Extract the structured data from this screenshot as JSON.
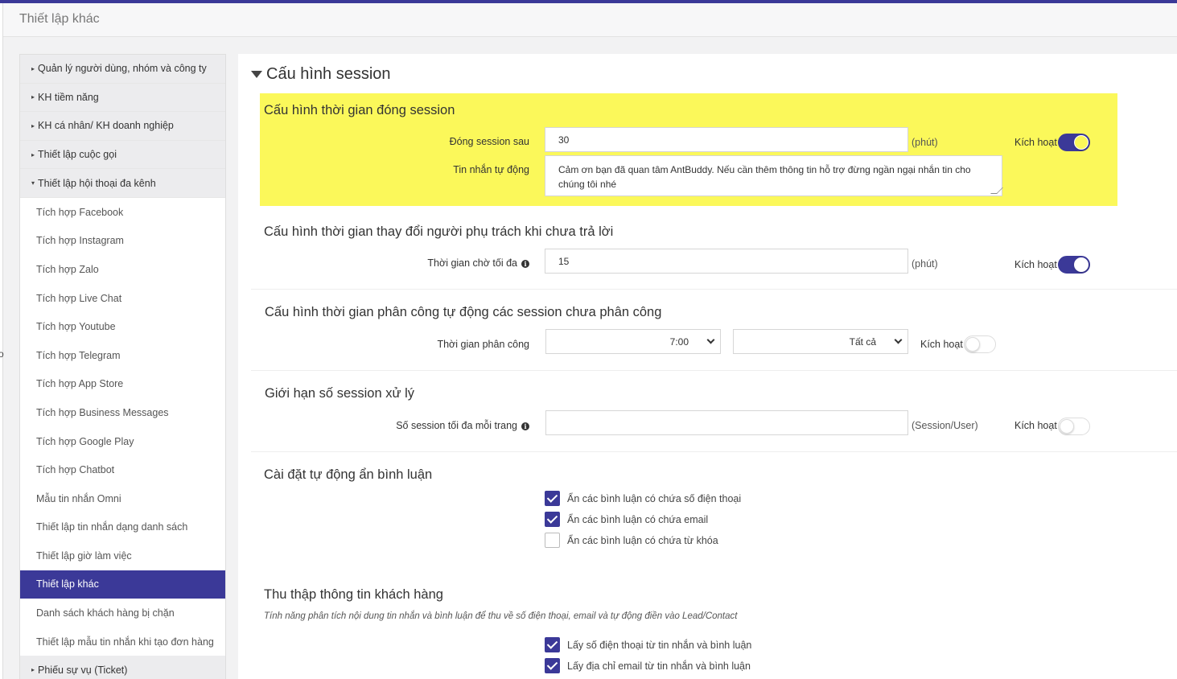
{
  "header": {
    "title": "Thiết lập khác"
  },
  "edge_mark": "o",
  "sidebar": {
    "items": [
      {
        "label": "Quản lý người dùng, nhóm và công ty",
        "type": "group",
        "caret": "▸"
      },
      {
        "label": "KH tiềm năng",
        "type": "group",
        "caret": "▸"
      },
      {
        "label": "KH cá nhân/ KH doanh nghiệp",
        "type": "group",
        "caret": "▸"
      },
      {
        "label": "Thiết lập cuộc gọi",
        "type": "group",
        "caret": "▸"
      },
      {
        "label": "Thiết lập hội thoại đa kênh",
        "type": "group",
        "caret": "▾"
      },
      {
        "label": "Tích hợp Facebook",
        "type": "sub"
      },
      {
        "label": "Tích hợp Instagram",
        "type": "sub"
      },
      {
        "label": "Tích hợp Zalo",
        "type": "sub"
      },
      {
        "label": "Tích hợp Live Chat",
        "type": "sub"
      },
      {
        "label": "Tích hợp Youtube",
        "type": "sub"
      },
      {
        "label": "Tích hợp Telegram",
        "type": "sub"
      },
      {
        "label": "Tích hợp App Store",
        "type": "sub"
      },
      {
        "label": "Tích hợp Business Messages",
        "type": "sub"
      },
      {
        "label": "Tích hợp Google Play",
        "type": "sub"
      },
      {
        "label": "Tích hợp Chatbot",
        "type": "sub"
      },
      {
        "label": "Mẫu tin nhắn Omni",
        "type": "sub"
      },
      {
        "label": "Thiết lập tin nhắn dạng danh sách",
        "type": "sub"
      },
      {
        "label": "Thiết lập giờ làm việc",
        "type": "sub"
      },
      {
        "label": "Thiết lập khác",
        "type": "sub",
        "active": true
      },
      {
        "label": "Danh sách khách hàng bị chặn",
        "type": "sub"
      },
      {
        "label": "Thiết lập mẫu tin nhắn khi tạo đơn hàng",
        "type": "sub"
      },
      {
        "label": "Phiếu sự vụ (Ticket)",
        "type": "group",
        "caret": "▸"
      }
    ]
  },
  "main": {
    "section_title": "Cấu hình session",
    "close_session": {
      "heading": "Cấu hình thời gian đóng session",
      "close_after_label": "Đóng session sau",
      "close_after_value": "30",
      "unit": "(phút)",
      "activate_label": "Kích hoạt",
      "activate_on": true,
      "auto_msg_label": "Tin nhắn tự động",
      "auto_msg_value": "Cảm ơn bạn đã quan tâm AntBuddy. Nếu cần thêm thông tin hỗ trợ đừng ngần ngại nhắn tin cho chúng tôi nhé"
    },
    "reassign": {
      "heading": "Cấu hình thời gian thay đổi người phụ trách khi chưa trả lời",
      "max_wait_label": "Thời gian chờ tối đa",
      "max_wait_value": "15",
      "unit": "(phút)",
      "activate_label": "Kích hoạt",
      "activate_on": true
    },
    "auto_assign": {
      "heading": "Cấu hình thời gian phân công tự động các session chưa phân công",
      "time_label": "Thời gian phân công",
      "time_value": "7:00",
      "scope_value": "Tất cả",
      "activate_label": "Kích hoạt",
      "activate_on": false
    },
    "limit": {
      "heading": "Giới hạn số session xử lý",
      "max_label": "Số session tối đa mỗi trang",
      "max_value": "",
      "unit": "(Session/User)",
      "activate_label": "Kích hoạt",
      "activate_on": false
    },
    "hide_comments": {
      "heading": "Cài đặt tự động ẩn bình luận",
      "options": [
        {
          "label": "Ẩn các bình luận có chứa số điện thoại",
          "checked": true
        },
        {
          "label": "Ẩn các bình luận có chứa email",
          "checked": true
        },
        {
          "label": "Ẩn các bình luận có chứa từ khóa",
          "checked": false
        }
      ]
    },
    "collect": {
      "heading": "Thu thập thông tin khách hàng",
      "note": "Tính năng phân tích nội dung tin nhắn và bình luận để thu về số điện thoại, email và tự động điền vào Lead/Contact",
      "options": [
        {
          "label": "Lấy số điện thoại từ tin nhắn và bình luận",
          "checked": true
        },
        {
          "label": "Lấy địa chỉ email từ tin nhắn và bình luận",
          "checked": true
        }
      ]
    }
  },
  "colors": {
    "accent": "#3b3998",
    "highlight": "#fbf85a"
  }
}
